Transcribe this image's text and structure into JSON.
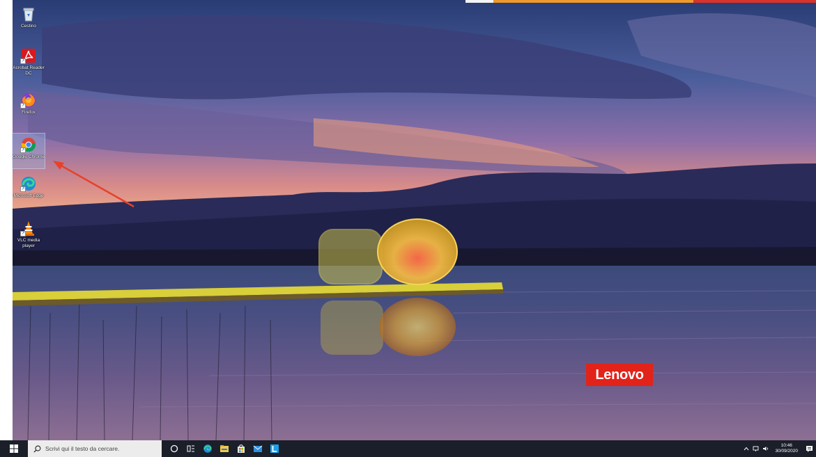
{
  "desktop": {
    "icons": [
      {
        "name": "recycle-bin",
        "label": "Cestino"
      },
      {
        "name": "acrobat",
        "label": "Acrobat Reader DC"
      },
      {
        "name": "firefox",
        "label": "Firefox"
      },
      {
        "name": "chrome",
        "label": "Google Chrome"
      },
      {
        "name": "edge",
        "label": "Microsoft Edge"
      },
      {
        "name": "vlc",
        "label": "VLC media player"
      }
    ],
    "brand": "Lenovo",
    "colors": {
      "lenovo_red": "#e2231a",
      "arrow": "#e8412a"
    }
  },
  "taskbar": {
    "search_placeholder": "Scrivi qui il testo da cercare.",
    "apps": [
      "cortana-icon",
      "task-view-icon",
      "edge-icon",
      "file-explorer-icon",
      "store-icon",
      "mail-icon",
      "lenovo-vantage-icon"
    ],
    "clock": {
      "time": "10:46",
      "date": "30/09/2020"
    }
  }
}
